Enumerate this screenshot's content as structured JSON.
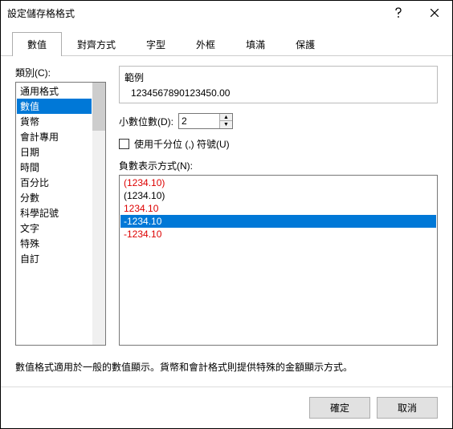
{
  "window": {
    "title": "設定儲存格格式"
  },
  "tabs": [
    "數值",
    "對齊方式",
    "字型",
    "外框",
    "填滿",
    "保護"
  ],
  "activeTab": 0,
  "category": {
    "label": "類別(C):",
    "items": [
      "通用格式",
      "數值",
      "貨幣",
      "會計專用",
      "日期",
      "時間",
      "百分比",
      "分數",
      "科學記號",
      "文字",
      "特殊",
      "自訂"
    ],
    "selected": 1
  },
  "sample": {
    "label": "範例",
    "value": "1234567890123450.00"
  },
  "decimals": {
    "label": "小數位數(D):",
    "value": "2"
  },
  "thousands": {
    "label": "使用千分位 (,) 符號(U)",
    "checked": false
  },
  "negative": {
    "label": "負數表示方式(N):",
    "items": [
      {
        "text": "(1234.10)",
        "style": "red"
      },
      {
        "text": "(1234.10)",
        "style": "black"
      },
      {
        "text": "1234.10",
        "style": "red"
      },
      {
        "text": "-1234.10",
        "style": "black"
      },
      {
        "text": "-1234.10",
        "style": "red"
      }
    ],
    "selected": 3
  },
  "description": "數值格式適用於一般的數值顯示。貨幣和會計格式則提供特殊的金額顯示方式。",
  "buttons": {
    "ok": "確定",
    "cancel": "取消"
  }
}
